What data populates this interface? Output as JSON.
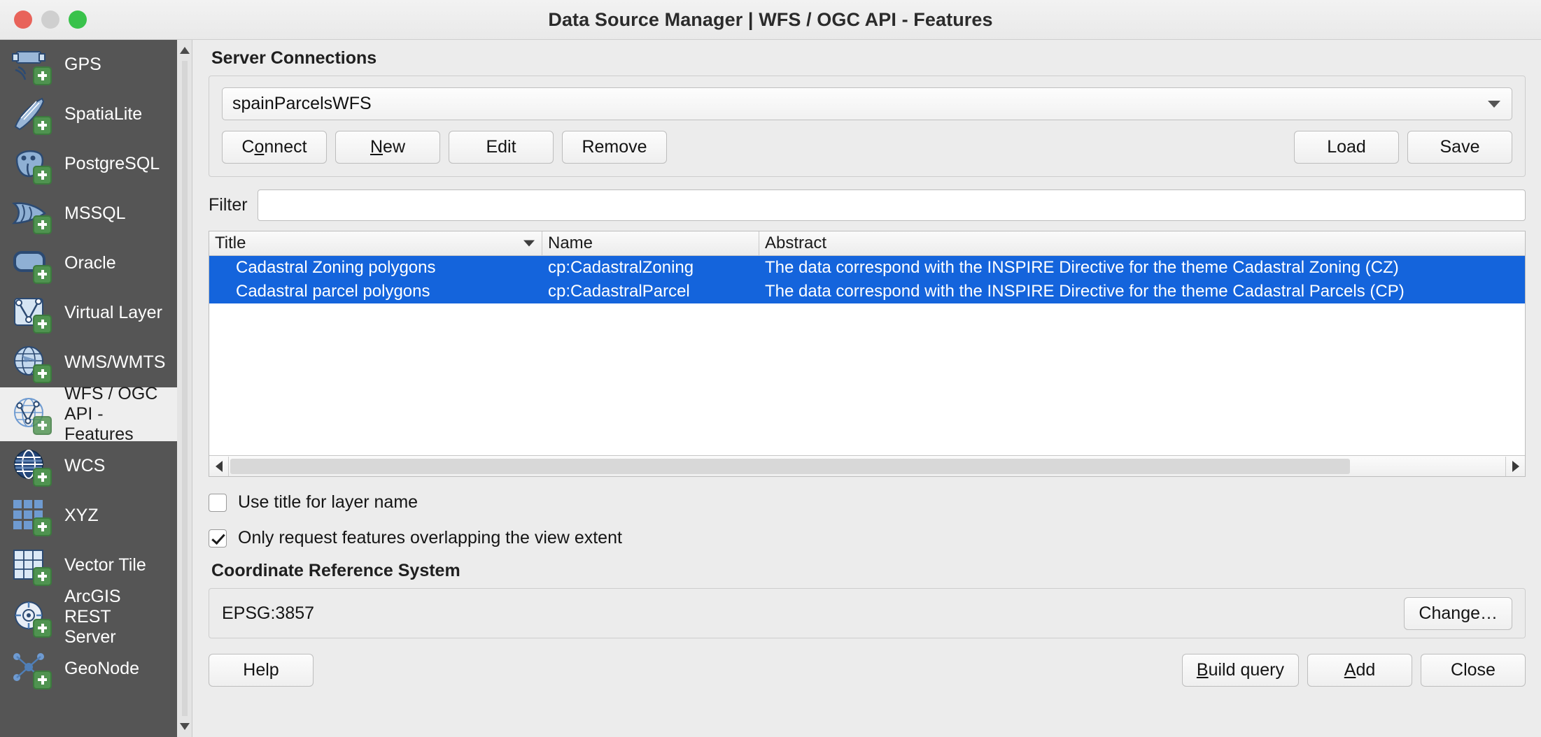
{
  "window": {
    "title": "Data Source Manager | WFS / OGC API - Features",
    "controls": [
      "close",
      "minimize",
      "zoom"
    ]
  },
  "sidebar": {
    "items": [
      {
        "label": "GPS",
        "icon": "gps-icon",
        "selected": false
      },
      {
        "label": "SpatiaLite",
        "icon": "spatialite-icon",
        "selected": false
      },
      {
        "label": "PostgreSQL",
        "icon": "postgresql-icon",
        "selected": false
      },
      {
        "label": "MSSQL",
        "icon": "mssql-icon",
        "selected": false
      },
      {
        "label": "Oracle",
        "icon": "oracle-icon",
        "selected": false
      },
      {
        "label": "Virtual Layer",
        "icon": "virtual-layer-icon",
        "selected": false
      },
      {
        "label": "WMS/WMTS",
        "icon": "wms-wmts-icon",
        "selected": false
      },
      {
        "label": "WFS / OGC\nAPI - Features",
        "icon": "wfs-ogc-api-features-icon",
        "selected": true
      },
      {
        "label": "WCS",
        "icon": "wcs-icon",
        "selected": false
      },
      {
        "label": "XYZ",
        "icon": "xyz-icon",
        "selected": false
      },
      {
        "label": "Vector Tile",
        "icon": "vector-tile-icon",
        "selected": false
      },
      {
        "label": "ArcGIS REST\nServer",
        "icon": "arcgis-rest-server-icon",
        "selected": false
      },
      {
        "label": "GeoNode",
        "icon": "geonode-icon",
        "selected": false
      }
    ]
  },
  "server_connections": {
    "heading": "Server Connections",
    "connection_value": "spainParcelsWFS",
    "buttons": {
      "connect": {
        "label": "Connect",
        "mnemonic_index": 1
      },
      "new": {
        "label": "New",
        "mnemonic_index": 0
      },
      "edit": {
        "label": "Edit",
        "mnemonic_index": -1
      },
      "remove": {
        "label": "Remove",
        "mnemonic_index": -1
      },
      "load": {
        "label": "Load",
        "mnemonic_index": -1
      },
      "save": {
        "label": "Save",
        "mnemonic_index": -1
      }
    }
  },
  "filter": {
    "label": "Filter",
    "value": "",
    "placeholder": ""
  },
  "results_table": {
    "columns": [
      "Title",
      "Name",
      "Abstract"
    ],
    "sorted_column": "Title",
    "sort_direction": "descending",
    "rows": [
      {
        "title": "Cadastral Zoning polygons",
        "name": "cp:CadastralZoning",
        "abstract": "The data correspond with the INSPIRE Directive for the theme Cadastral Zoning (CZ)",
        "selected": true
      },
      {
        "title": "Cadastral parcel polygons",
        "name": "cp:CadastralParcel",
        "abstract": "The data correspond with the INSPIRE Directive for the theme Cadastral Parcels (CP)",
        "selected": true
      }
    ]
  },
  "options": {
    "use_title_for_layer_name": {
      "label": "Use title for layer name",
      "checked": false
    },
    "only_request_overlapping": {
      "label": "Only request features overlapping the view extent",
      "checked": true
    }
  },
  "crs": {
    "heading": "Coordinate Reference System",
    "value": "EPSG:3857",
    "change_button": "Change…"
  },
  "footer": {
    "help": {
      "label": "Help"
    },
    "build_query": {
      "label": "Build query",
      "mnemonic_index": 0
    },
    "add": {
      "label": "Add",
      "mnemonic_index": 0
    },
    "close": {
      "label": "Close"
    }
  },
  "colors": {
    "selection_blue": "#1464dc",
    "sidebar_bg": "#555555",
    "panel_bg": "#ececec",
    "accent_green": "#4f9350"
  }
}
